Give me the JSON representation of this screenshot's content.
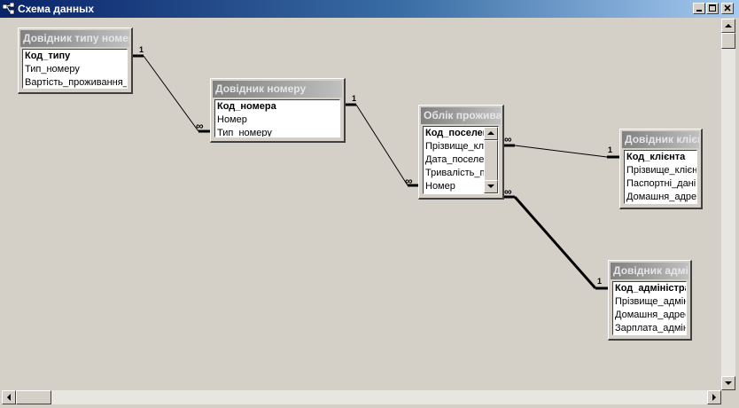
{
  "window": {
    "title": "Схема данных"
  },
  "tables": [
    {
      "title": "Довідник типу номеру",
      "fields": [
        "Код_типу",
        "Тип_номеру",
        "Вартість_проживання_"
      ]
    },
    {
      "title": "Довідник номеру",
      "fields": [
        "Код_номера",
        "Номер",
        "Тип_номеру"
      ]
    },
    {
      "title": "Облік проживання",
      "fields": [
        "Код_поселення",
        "Прізвище_клієнта",
        "Дата_поселення",
        "Тривалість_проживання",
        "Номер"
      ]
    },
    {
      "title": "Довідник клієнтів",
      "fields": [
        "Код_клієнта",
        "Прізвище_клієнта",
        "Паспортні_дані",
        "Домашня_адреса"
      ]
    },
    {
      "title": "Довідник адміністраторів",
      "fields": [
        "Код_адміністратора",
        "Прізвище_адміністратора",
        "Домашня_адреса",
        "Зарплата_адміністратора"
      ]
    }
  ],
  "relationships": {
    "one_label": "1",
    "many_label": "∞"
  }
}
